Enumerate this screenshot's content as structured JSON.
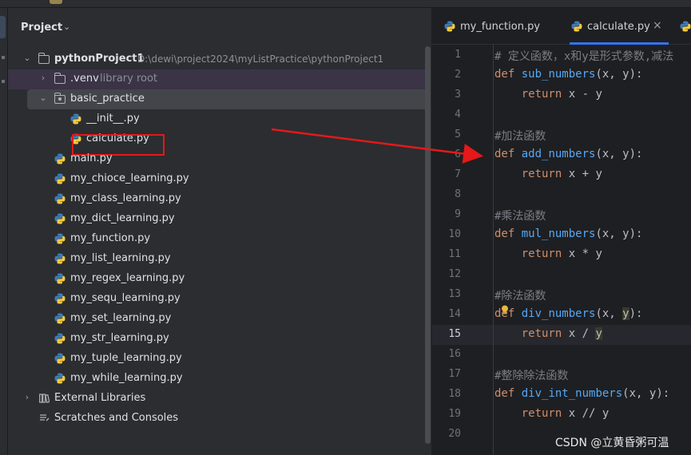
{
  "colors": {
    "panel_bg": "#2b2d30",
    "editor_bg": "#1e1f22",
    "keyword": "#cf8e6d",
    "function": "#56a8f5",
    "comment": "#7a7e85",
    "annotation_red": "#e5181a",
    "tab_accent": "#3574f0"
  },
  "project_panel": {
    "title": "Project",
    "chevron": "⌄",
    "root": {
      "name": "pythonProject1",
      "path": "D:\\dewi\\project2024\\myListPractice\\pythonProject1",
      "icon": "folder-icon"
    },
    "venv": {
      "name": ".venv",
      "badge": "library root",
      "icon": "folder-icon"
    },
    "package": {
      "name": "basic_practice",
      "icon": "package-folder-icon"
    },
    "package_files": [
      "__init__.py",
      "calculate.py"
    ],
    "files": [
      "main.py",
      "my_chioce_learning.py",
      "my_class_learning.py",
      "my_dict_learning.py",
      "my_function.py",
      "my_list_learning.py",
      "my_regex_learning.py",
      "my_sequ_learning.py",
      "my_set_learning.py",
      "my_str_learning.py",
      "my_tuple_learning.py",
      "my_while_learning.py"
    ],
    "external_libraries": "External Libraries",
    "scratches": "Scratches and Consoles"
  },
  "editor": {
    "tabs": [
      {
        "label": "my_function.py",
        "active": false
      },
      {
        "label": "calculate.py",
        "active": true,
        "close": "×"
      }
    ],
    "line_numbers": [
      "1",
      "2",
      "3",
      "4",
      "5",
      "6",
      "7",
      "8",
      "9",
      "10",
      "11",
      "12",
      "13",
      "14",
      "15",
      "16",
      "17",
      "18",
      "19",
      "20"
    ],
    "current_line": "15",
    "code": {
      "l1": "# 定义函数，x和y是形式参数,减法",
      "l2_kw": "def",
      "l2_fn": "sub_numbers",
      "l2_rest": "(x, y):",
      "l3_kw": "return",
      "l3_rest": " x - y",
      "l5": "#加法函数",
      "l6_kw": "def",
      "l6_fn": "add_numbers",
      "l6_rest": "(x, y):",
      "l7_kw": "return",
      "l7_rest": " x + y",
      "l9": "#乘法函数",
      "l10_kw": "def",
      "l10_fn": "mul_numbers",
      "l10_rest": "(x, y):",
      "l11_kw": "return",
      "l11_rest": " x * y",
      "l13": "#除法函数",
      "l14_kw": "def",
      "l14_fn": "div_numbers",
      "l14_a": "(x, ",
      "l14_y": "y",
      "l14_b": "):",
      "l15_kw": "return",
      "l15_a": " x / ",
      "l15_y": "y",
      "l17": "#整除除法函数",
      "l18_kw": "def",
      "l18_fn": "div_int_numbers",
      "l18_rest": "(x, y):",
      "l19_kw": "return",
      "l19_rest": " x // y"
    }
  },
  "watermark": "CSDN @立黄昏粥可温"
}
